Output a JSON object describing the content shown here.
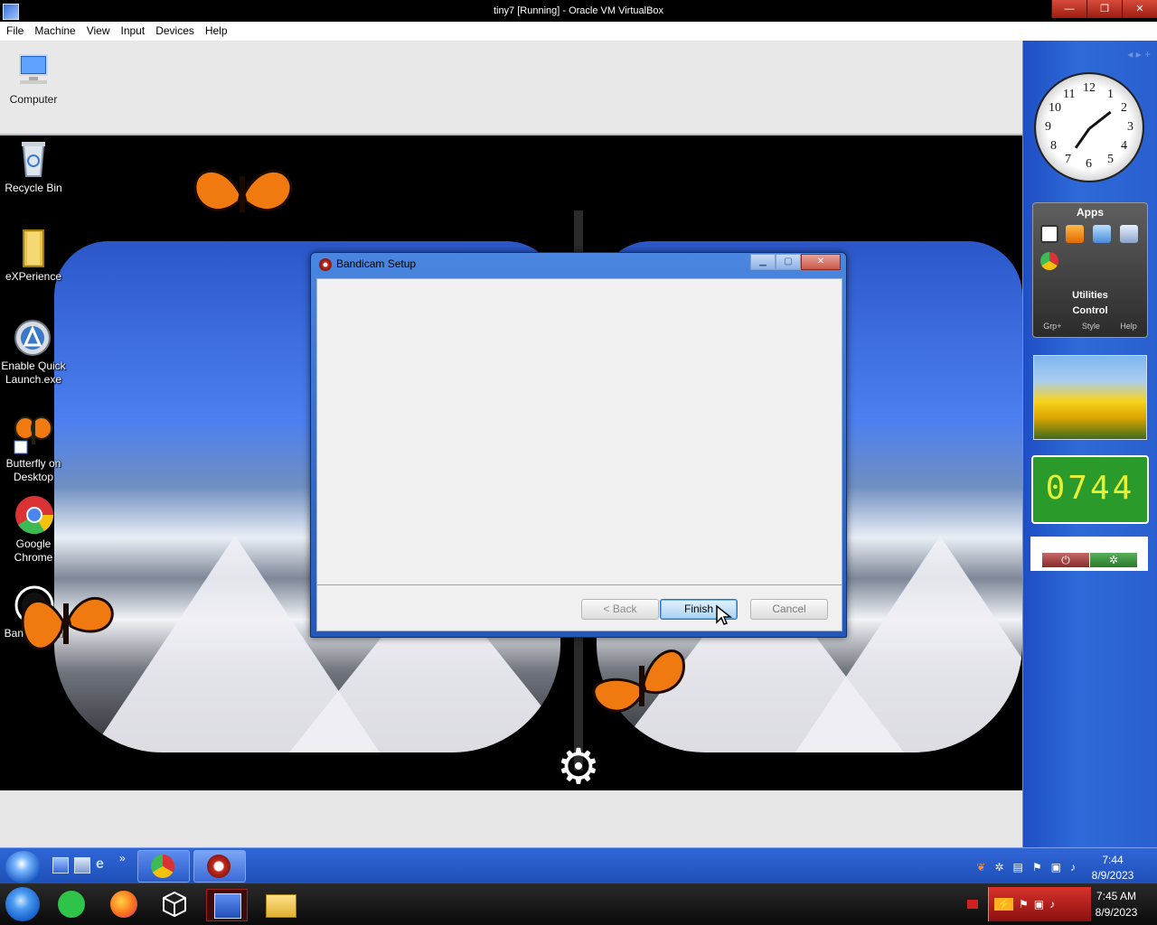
{
  "host_window": {
    "title": "tiny7 [Running] - Oracle VM VirtualBox",
    "controls": {
      "minimize": "—",
      "restore": "❐",
      "close": "✕"
    }
  },
  "menu": [
    "File",
    "Machine",
    "View",
    "Input",
    "Devices",
    "Help"
  ],
  "desktop_icons": [
    {
      "name": "icon-computer",
      "label": "Computer",
      "icon": "computer-icon"
    },
    {
      "name": "icon-recycle-bin",
      "label": "Recycle Bin",
      "icon": "recycle-bin-icon"
    },
    {
      "name": "icon-experience",
      "label": "eXPerience",
      "icon": "folder-icon"
    },
    {
      "name": "icon-enable-quick-launch",
      "label": "Enable Quick Launch.exe",
      "icon": "quick-launch-icon"
    },
    {
      "name": "icon-butterfly-on-desktop",
      "label": "Butterfly on Desktop",
      "icon": "butterfly-icon"
    },
    {
      "name": "icon-google-chrome",
      "label": "Google Chrome",
      "icon": "chrome-icon"
    },
    {
      "name": "icon-bandicam",
      "label": "Ban          m",
      "icon": "bandicam-icon"
    }
  ],
  "dialog": {
    "title": "Bandicam Setup",
    "back_label": "< Back",
    "finish_label": "Finish",
    "cancel_label": "Cancel"
  },
  "gadgets": {
    "nav": "◂ ▸  +",
    "clock_numbers": [
      "12",
      "1",
      "2",
      "3",
      "4",
      "5",
      "6",
      "7",
      "8",
      "9",
      "10",
      "11"
    ],
    "apps_title": "Apps",
    "apps_utilities": "Utilities",
    "apps_control": "Control",
    "apps_links": [
      "Grp+",
      "Style",
      "Help"
    ],
    "digital_time": "0744",
    "power_symbol": "⏻",
    "sleep_symbol": "✲"
  },
  "guest_taskbar": {
    "overflow": "»",
    "time": "7:44",
    "date": "8/9/2023"
  },
  "host_taskbar": {
    "time": "7:45 AM",
    "date": "8/9/2023"
  },
  "colors": {
    "dialog_frame": "#2458b8",
    "taskbar": "#1f4fb8",
    "digital_clock_bg": "#2a9a2a",
    "digital_clock_fg": "#e8f032",
    "host_tray": "#c0201a"
  }
}
